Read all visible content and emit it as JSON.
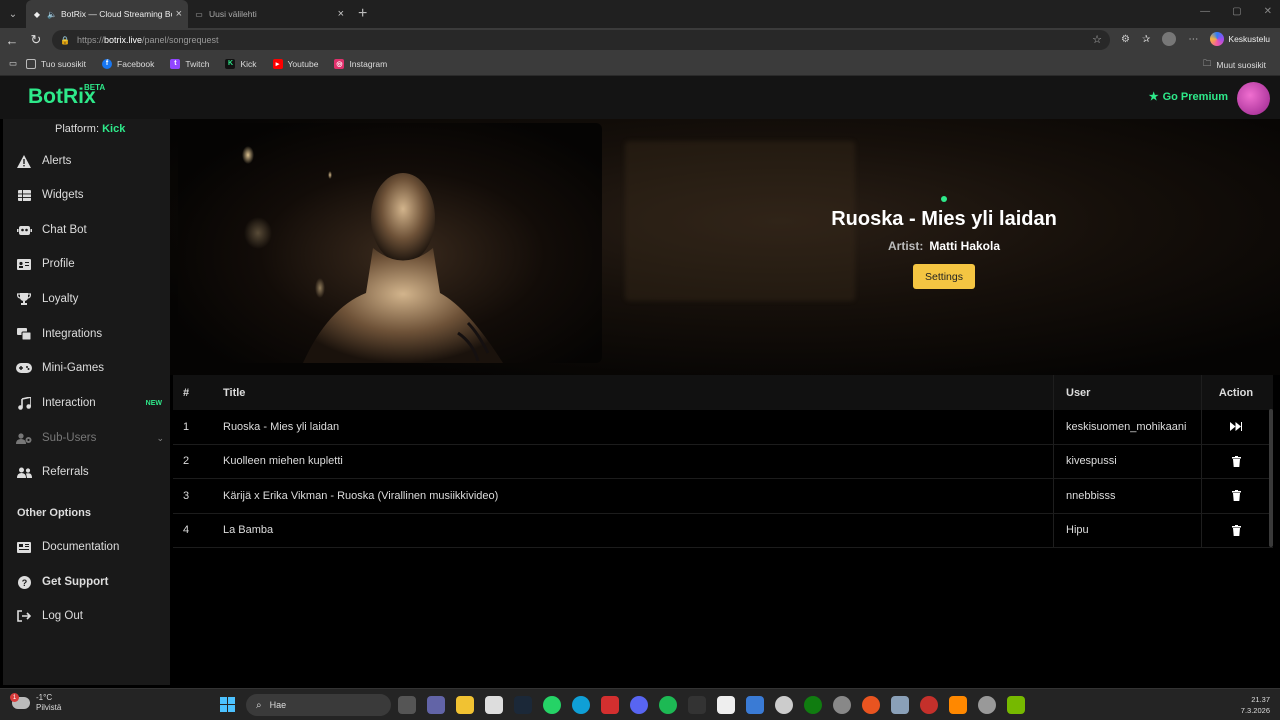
{
  "browser": {
    "tabs": [
      {
        "title": "BotRix — Cloud Streaming Bot",
        "active": true
      },
      {
        "title": "Uusi välilehti",
        "active": false
      }
    ],
    "url_prefix": "https://",
    "url_host": "botrix.live",
    "url_path": "/panel/songrequest",
    "copilot_label": "Keskustelu",
    "bookmarks": [
      {
        "label": "Tuo suosikit",
        "icon": "import-icon",
        "color": "#888888"
      },
      {
        "label": "Facebook",
        "icon": "facebook-icon",
        "color": "#1877f2"
      },
      {
        "label": "Twitch",
        "icon": "twitch-icon",
        "color": "#9146ff"
      },
      {
        "label": "Kick",
        "icon": "kick-icon",
        "color": "#2ee98a"
      },
      {
        "label": "Youtube",
        "icon": "youtube-icon",
        "color": "#ff0000"
      },
      {
        "label": "Instagram",
        "icon": "instagram-icon",
        "color": "#e1306c"
      }
    ],
    "other_bookmarks": "Muut suosikit"
  },
  "header": {
    "logo": "BotRix",
    "beta": "BETA",
    "premium": "Go Premium",
    "accent": "#2ee98a"
  },
  "sidebar": {
    "platform_label": "Platform:",
    "platform_value": "Kick",
    "items": [
      {
        "label": "Alerts",
        "icon": "warning-icon"
      },
      {
        "label": "Widgets",
        "icon": "widgets-icon"
      },
      {
        "label": "Chat Bot",
        "icon": "robot-icon"
      },
      {
        "label": "Profile",
        "icon": "id-card-icon"
      },
      {
        "label": "Loyalty",
        "icon": "trophy-icon"
      },
      {
        "label": "Integrations",
        "icon": "integrations-icon"
      },
      {
        "label": "Mini-Games",
        "icon": "gamepad-icon"
      },
      {
        "label": "Interaction",
        "icon": "music-icon",
        "badge": "NEW"
      },
      {
        "label": "Sub-Users",
        "icon": "users-cog-icon",
        "disabled": true
      },
      {
        "label": "Referrals",
        "icon": "referrals-icon"
      }
    ],
    "other_options_title": "Other Options",
    "other_items": [
      {
        "label": "Documentation",
        "icon": "documentation-icon"
      },
      {
        "label": "Get Support",
        "icon": "question-icon"
      },
      {
        "label": "Log Out",
        "icon": "logout-icon"
      }
    ]
  },
  "now_playing": {
    "title": "Ruoska - Mies yli laidan",
    "artist_label": "Artist:",
    "artist": "Matti Hakola",
    "settings_label": "Settings"
  },
  "queue": {
    "headers": {
      "num": "#",
      "title": "Title",
      "user": "User",
      "action": "Action"
    },
    "rows": [
      {
        "num": "1",
        "title": "Ruoska - Mies yli laidan",
        "user": "keskisuomen_mohikaani",
        "action": "skip"
      },
      {
        "num": "2",
        "title": "Kuolleen miehen kupletti",
        "user": "kivespussi",
        "action": "delete"
      },
      {
        "num": "3",
        "title": "Kärijä x Erika Vikman - Ruoska (Virallinen musiikkivideo)",
        "user": "nnebbisss",
        "action": "delete"
      },
      {
        "num": "4",
        "title": "La Bamba",
        "user": "Hipu",
        "action": "delete"
      }
    ]
  },
  "taskbar": {
    "temp": "-1°C",
    "weather": "Pilvistä",
    "weather_badge": "1",
    "search": "Hae",
    "time": "21.37",
    "date": "7.3.2026"
  }
}
